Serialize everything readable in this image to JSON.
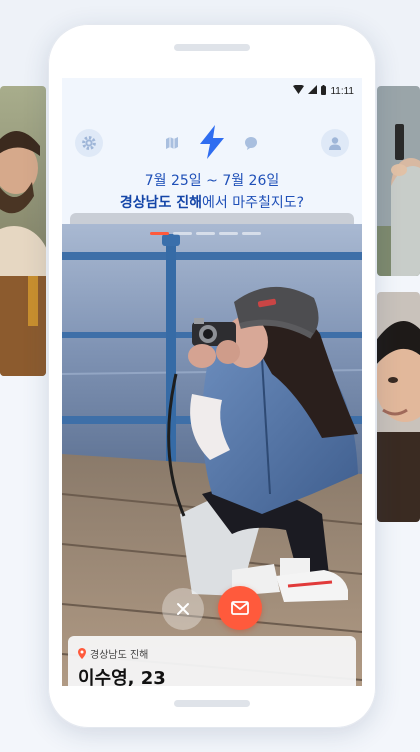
{
  "status_bar": {
    "time": "11:11"
  },
  "header": {
    "date_range": "7월 25일 ~ 7월 26일",
    "question_location": "경상남도 진해",
    "question_suffix": "에서 마주칠지도?"
  },
  "nav": {
    "settings_icon": "gear-icon",
    "map_icon": "map-icon",
    "main_icon": "lightning-icon",
    "chat_icon": "chat-bubble-icon",
    "profile_icon": "person-icon"
  },
  "profile_card": {
    "location": "경상남도 진해",
    "name_age": "이수영, 23",
    "photo_count": 5,
    "current_photo": 1
  },
  "colors": {
    "accent_blue": "#2f6df0",
    "accent_orange": "#ff5a3c",
    "text_blue": "#1f50b8"
  }
}
